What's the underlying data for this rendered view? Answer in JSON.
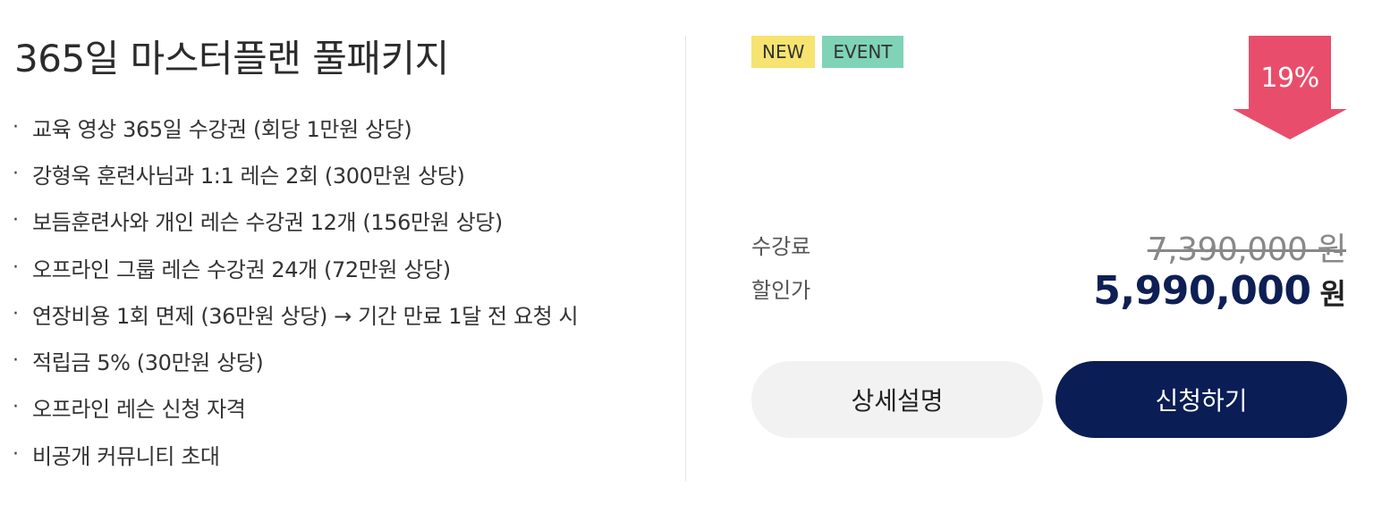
{
  "product": {
    "title": "365일 마스터플랜 풀패키지",
    "bullet_symbol": "·",
    "features": [
      "교육 영상 365일 수강권 (회당 1만원 상당)",
      "강형욱 훈련사님과 1:1 레슨 2회 (300만원 상당)",
      "보듬훈련사와 개인 레슨 수강권 12개 (156만원 상당)",
      "오프라인 그룹 레슨 수강권 24개 (72만원 상당)",
      "연장비용 1회 면제 (36만원 상당) → 기간 만료 1달 전 요청 시",
      "적립금 5% (30만원 상당)",
      "오프라인 레슨 신청 자격",
      "비공개 커뮤니티 초대"
    ]
  },
  "badges": {
    "new": "NEW",
    "event": "EVENT"
  },
  "discount": {
    "label": "19%",
    "color": "#e94d6c"
  },
  "pricing": {
    "regular_label": "수강료",
    "regular_price": "7,390,000 원",
    "sale_label": "할인가",
    "sale_amount": "5,990,000",
    "sale_unit": "원"
  },
  "actions": {
    "detail_label": "상세설명",
    "apply_label": "신청하기"
  },
  "colors": {
    "badge_new": "#f7e36f",
    "badge_event": "#7fd3b7",
    "primary": "#0b1d55",
    "secondary_button": "#f2f2f2"
  }
}
